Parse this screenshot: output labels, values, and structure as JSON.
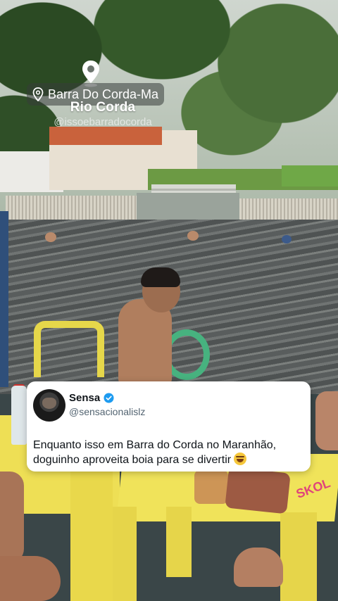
{
  "location_overlay": {
    "place": "Barra Do Corda-Ma",
    "title": "Rio Corda",
    "handle": "@issoebarradocorda"
  },
  "tweet": {
    "name": "Sensa",
    "handle": "@sensacionalislz",
    "text": "Enquanto isso em Barra do Corda no Maranhão, doguinho aproveita boia para se divertir",
    "verified_color": "#1d9bf0"
  },
  "scene": {
    "brand_on_table": "SKOL"
  }
}
